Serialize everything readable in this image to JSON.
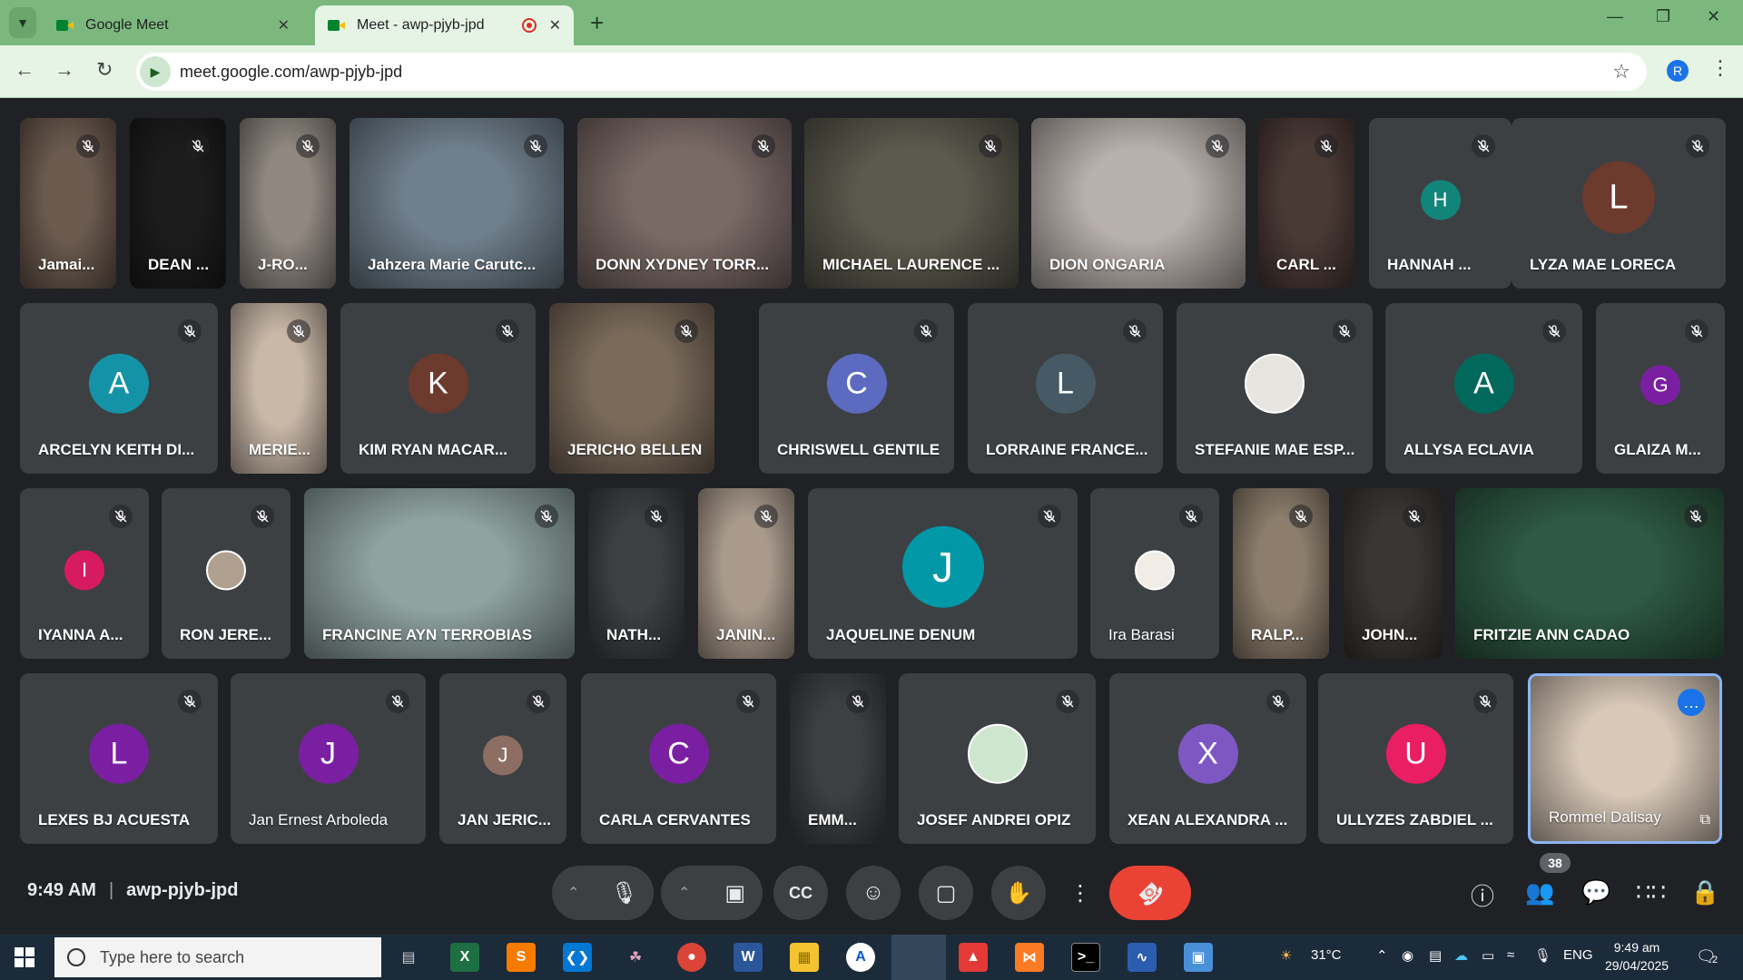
{
  "browser": {
    "tabs": [
      {
        "title": "Google Meet"
      },
      {
        "title": "Meet - awp-pjyb-jpd"
      }
    ],
    "url": "meet.google.com/awp-pjyb-jpd",
    "profile_initial": "R"
  },
  "tiles": [
    {
      "name": "Jamai...",
      "kind": "video",
      "bg": "#6b5a4e"
    },
    {
      "name": "DEAN ...",
      "kind": "video",
      "bg": "#1c1c1c"
    },
    {
      "name": "J-RO...",
      "kind": "video",
      "bg": "#8f8780"
    },
    {
      "name": "Jahzera Marie Carutc...",
      "kind": "video",
      "bg": "#6f7f8c"
    },
    {
      "name": "DONN XYDNEY TORR...",
      "kind": "video",
      "bg": "#7a6a66"
    },
    {
      "name": "MICHAEL LAURENCE ...",
      "kind": "video",
      "bg": "#5c5a4e"
    },
    {
      "name": "DION ONGARIA",
      "kind": "video",
      "bg": "#b8b0ac"
    },
    {
      "name": "CARL ...",
      "kind": "video",
      "bg": "#4a3a36"
    },
    {
      "name": "HANNAH ...",
      "kind": "avatar",
      "initial": "H",
      "color": "#12857a",
      "size": "sm"
    },
    {
      "name": "LYZA MAE LORECA",
      "kind": "avatar",
      "initial": "L",
      "color": "#6d3a2e",
      "size": "lg"
    },
    {
      "name": "ARCELYN KEITH DI...",
      "kind": "avatar",
      "initial": "A",
      "color": "#1493a7",
      "size": "md"
    },
    {
      "name": "MERIE...",
      "kind": "video",
      "bg": "#c9b8a8"
    },
    {
      "name": "KIM RYAN MACAR...",
      "kind": "avatar",
      "initial": "K",
      "color": "#6d3a2e",
      "size": "md"
    },
    {
      "name": "JERICHO BELLEN",
      "kind": "video",
      "bg": "#7a6a5a"
    },
    {
      "name": "CHRISWELL GENTILE",
      "kind": "avatar",
      "initial": "C",
      "color": "#5c6bc0",
      "size": "md"
    },
    {
      "name": "LORRAINE FRANCE...",
      "kind": "avatar",
      "initial": "L",
      "color": "#455a64",
      "size": "md"
    },
    {
      "name": "STEFANIE MAE ESP...",
      "kind": "photo",
      "color": "#e8e4e0",
      "size": "md"
    },
    {
      "name": "ALLYSA ECLAVIA",
      "kind": "avatar",
      "initial": "A",
      "color": "#00695c",
      "size": "md"
    },
    {
      "name": "GLAIZA M...",
      "kind": "avatar",
      "initial": "G",
      "color": "#7b1fa2",
      "size": "sm"
    },
    {
      "name": "IYANNA A...",
      "kind": "avatar",
      "initial": "I",
      "color": "#d81b60",
      "size": "sm"
    },
    {
      "name": "RON JERE...",
      "kind": "photo",
      "color": "#b0a090",
      "size": "sm"
    },
    {
      "name": "FRANCINE AYN TERROBIAS",
      "kind": "video",
      "bg": "#8fa3a0"
    },
    {
      "name": "NATH...",
      "kind": "video",
      "bg": "#3c4043"
    },
    {
      "name": "JANIN...",
      "kind": "video",
      "bg": "#a99a8c"
    },
    {
      "name": "JAQUELINE DENUM",
      "kind": "avatar",
      "initial": "J",
      "color": "#0097a7",
      "size": "xl"
    },
    {
      "name": "Ira Barasi",
      "kind": "photo",
      "color": "#f1ece6",
      "size": "sm",
      "normal": true
    },
    {
      "name": "RALP...",
      "kind": "video",
      "bg": "#8c7d6c"
    },
    {
      "name": "JOHN...",
      "kind": "video",
      "bg": "#3a3633"
    },
    {
      "name": "FRITZIE ANN CADAO",
      "kind": "video",
      "bg": "#2e5a44"
    },
    {
      "name": "LEXES BJ ACUESTA",
      "kind": "avatar",
      "initial": "L",
      "color": "#7b1fa2",
      "size": "md"
    },
    {
      "name": "Jan Ernest Arboleda",
      "kind": "avatar",
      "initial": "J",
      "color": "#7b1fa2",
      "size": "md",
      "normal": true
    },
    {
      "name": "JAN JERIC...",
      "kind": "avatar",
      "initial": "J",
      "color": "#8d6e63",
      "size": "sm"
    },
    {
      "name": "CARLA CERVANTES",
      "kind": "avatar",
      "initial": "C",
      "color": "#7b1fa2",
      "size": "md"
    },
    {
      "name": "EMM...",
      "kind": "video",
      "bg": "#3c4043"
    },
    {
      "name": "JOSEF ANDREI OPIZ",
      "kind": "photo",
      "color": "#cfe6cf",
      "size": "md"
    },
    {
      "name": "XEAN ALEXANDRA ...",
      "kind": "avatar",
      "initial": "X",
      "color": "#7e57c2",
      "size": "md"
    },
    {
      "name": "ULLYZES ZABDIEL ...",
      "kind": "avatar",
      "initial": "U",
      "color": "#e91e63",
      "size": "md"
    },
    {
      "name": "Rommel Dalisay",
      "kind": "self",
      "bg": "#d8c8b8",
      "normal": true
    }
  ],
  "bottom": {
    "time": "9:49 AM",
    "meeting_code": "awp-pjyb-jpd",
    "participant_count": "38"
  },
  "taskbar": {
    "search_placeholder": "Type here to search",
    "weather": "31°C",
    "language": "ENG",
    "time": "9:49 am",
    "date": "29/04/2025",
    "notifications": "2"
  }
}
